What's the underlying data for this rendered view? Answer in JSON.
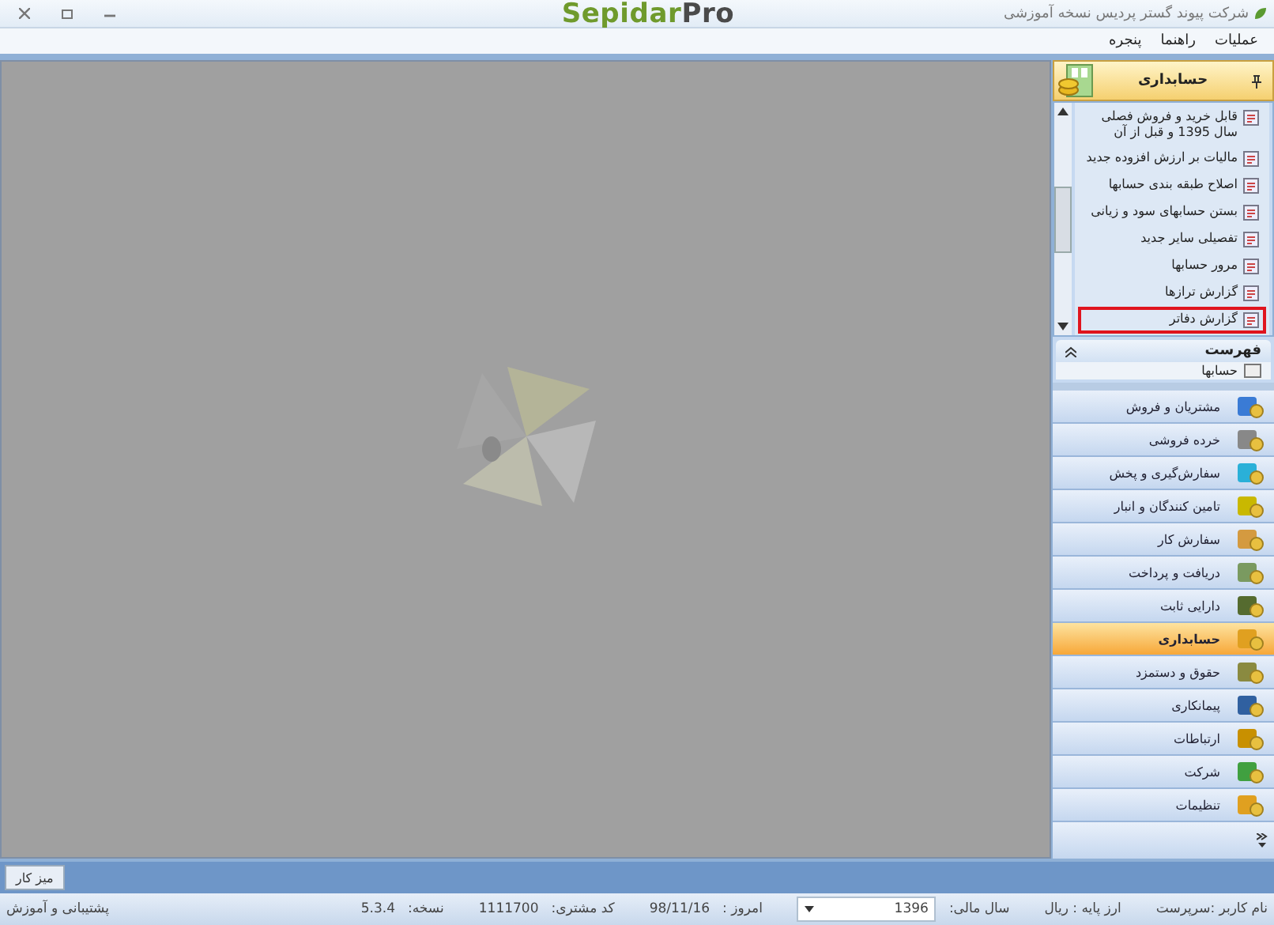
{
  "window": {
    "title": "شرکت پیوند گستر پردیس نسخه آموزشی",
    "logo": {
      "primary": "Sepidar",
      "secondary": "Pro"
    }
  },
  "menu": [
    "عملیات",
    "راهنما",
    "پنجره"
  ],
  "panel": {
    "title": "حسابداری",
    "items": [
      {
        "label": "قابل خرید و فروش فصلی سال 1395 و قبل از آن",
        "highlighted": false
      },
      {
        "label": "مالیات بر ارزش افزوده جدید",
        "highlighted": false
      },
      {
        "label": "اصلاح طبقه بندی حسابها",
        "highlighted": false
      },
      {
        "label": "بستن حسابهای سود و زیانی",
        "highlighted": false
      },
      {
        "label": "تفصیلی سایر جدید",
        "highlighted": false
      },
      {
        "label": "مرور حسابها",
        "highlighted": false
      },
      {
        "label": "گزارش ترازها",
        "highlighted": false
      },
      {
        "label": "گزارش دفاتر",
        "highlighted": true
      }
    ],
    "section": {
      "title": "فهرست",
      "items": [
        "حسابها"
      ]
    }
  },
  "nav": [
    {
      "label": "مشتریان و فروش",
      "selected": false
    },
    {
      "label": "خرده فروشی",
      "selected": false
    },
    {
      "label": "سفارش‌گیری و پخش",
      "selected": false
    },
    {
      "label": "تامین کنندگان و انبار",
      "selected": false
    },
    {
      "label": "سفارش کار",
      "selected": false
    },
    {
      "label": "دریافت و پرداخت",
      "selected": false
    },
    {
      "label": "دارایی ثابت",
      "selected": false
    },
    {
      "label": "حسابداری",
      "selected": true
    },
    {
      "label": "حقوق و دستمزد",
      "selected": false
    },
    {
      "label": "پیمانکاری",
      "selected": false
    },
    {
      "label": "ارتباطات",
      "selected": false
    },
    {
      "label": "شرکت",
      "selected": false
    },
    {
      "label": "تنظیمات",
      "selected": false
    }
  ],
  "taskbar": {
    "button": "میز کار"
  },
  "status_bar": {
    "user": "نام کاربر :سرپرست",
    "currency": "ارز پایه :  ریال",
    "fiscal_year_label": "سال مالی:",
    "fiscal_year": "1396",
    "today_label": "امروز :",
    "today": "98/11/16",
    "customer_label": "کد مشتری:",
    "customer": "1111700",
    "version_label": "نسخه:",
    "version": "5.3.4",
    "support": "پشتیبانی و آموزش"
  }
}
